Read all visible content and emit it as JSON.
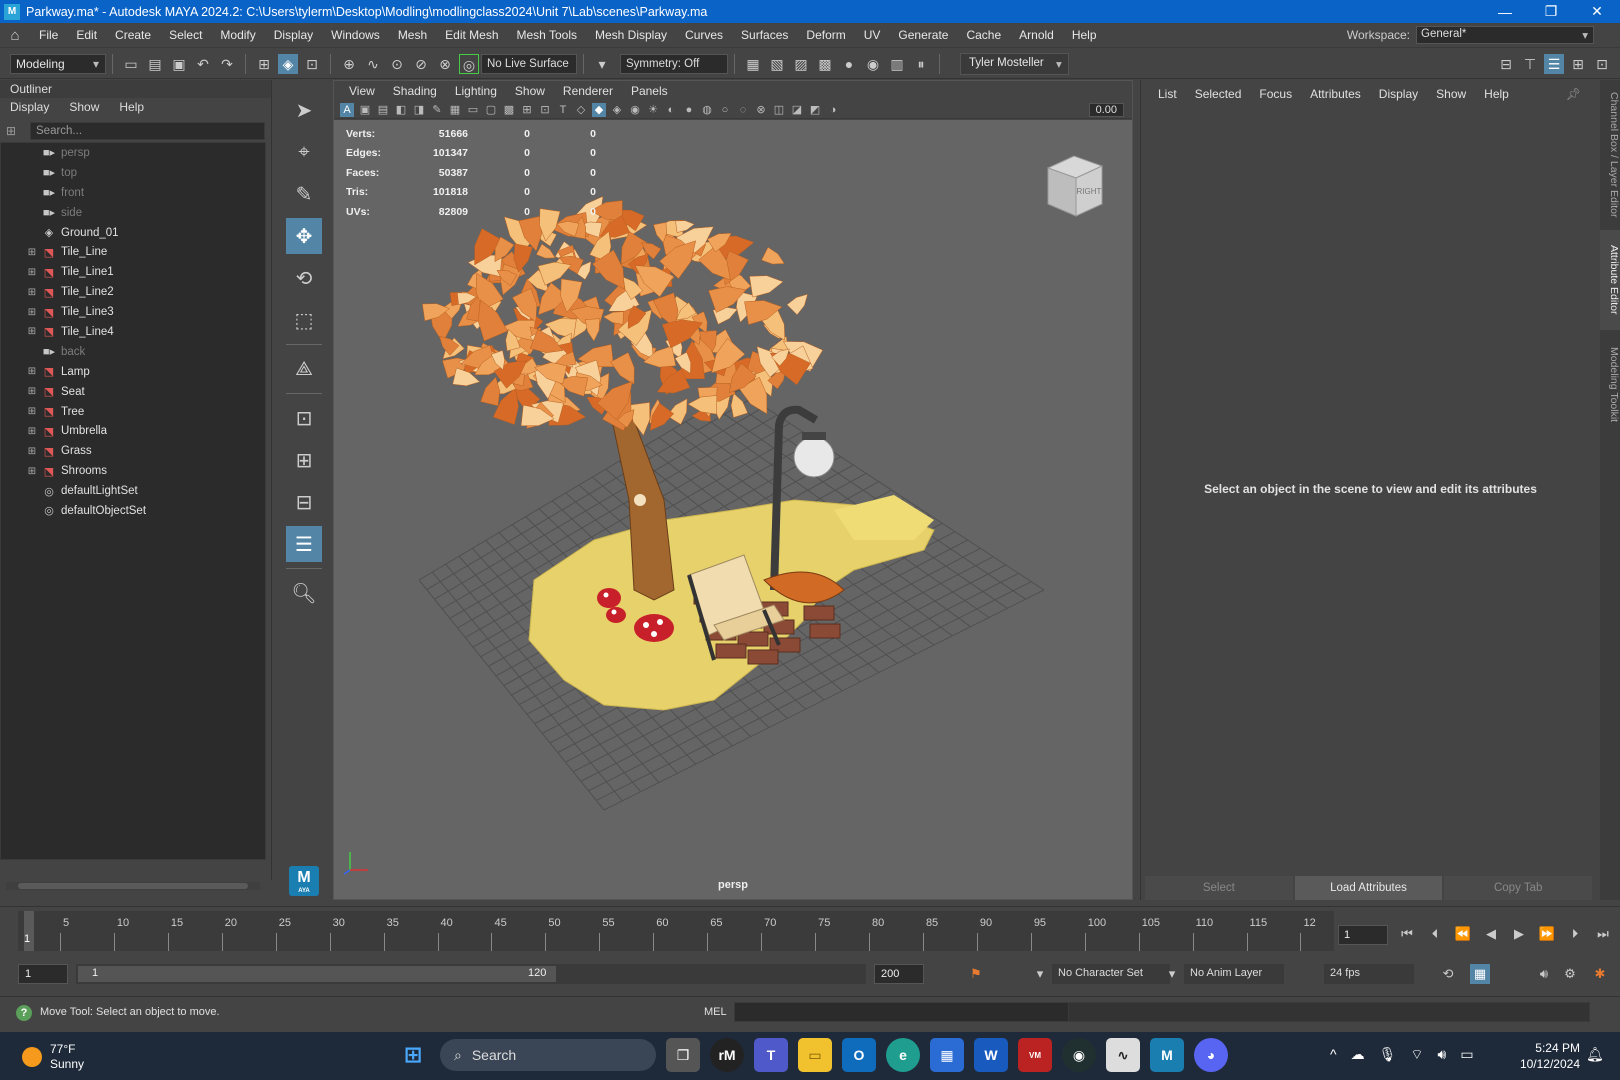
{
  "window": {
    "title": "Parkway.ma* - Autodesk MAYA 2024.2: C:\\Users\\tylerm\\Desktop\\Modling\\modlingclass2024\\Unit 7\\Lab\\scenes\\Parkway.ma",
    "logo": "M",
    "controls": [
      "—",
      "❐",
      "✕"
    ]
  },
  "menubar": {
    "items": [
      "File",
      "Edit",
      "Create",
      "Select",
      "Modify",
      "Display",
      "Windows",
      "Mesh",
      "Edit Mesh",
      "Mesh Tools",
      "Mesh Display",
      "Curves",
      "Surfaces",
      "Deform",
      "UV",
      "Generate",
      "Cache",
      "Arnold",
      "Help"
    ],
    "workspace_label": "Workspace:",
    "workspace_value": "General*"
  },
  "statusline": {
    "mode": "Modeling",
    "live_surface": "No Live Surface",
    "symmetry": "Symmetry: Off",
    "user": "Tyler Mosteller"
  },
  "outliner": {
    "title": "Outliner",
    "menu": [
      "Display",
      "Show",
      "Help"
    ],
    "search_placeholder": "Search...",
    "items": [
      {
        "label": "persp",
        "icon": "camera-icon",
        "dim": true,
        "expandable": false
      },
      {
        "label": "top",
        "icon": "camera-icon",
        "dim": true,
        "expandable": false
      },
      {
        "label": "front",
        "icon": "camera-icon",
        "dim": true,
        "expandable": false
      },
      {
        "label": "side",
        "icon": "camera-icon",
        "dim": true,
        "expandable": false
      },
      {
        "label": "Ground_01",
        "icon": "mesh-icon",
        "dim": false,
        "expandable": false
      },
      {
        "label": "Tile_Line",
        "icon": "group-icon",
        "dim": false,
        "expandable": true
      },
      {
        "label": "Tile_Line1",
        "icon": "group-icon",
        "dim": false,
        "expandable": true
      },
      {
        "label": "Tile_Line2",
        "icon": "group-icon",
        "dim": false,
        "expandable": true
      },
      {
        "label": "Tile_Line3",
        "icon": "group-icon",
        "dim": false,
        "expandable": true
      },
      {
        "label": "Tile_Line4",
        "icon": "group-icon",
        "dim": false,
        "expandable": true
      },
      {
        "label": "back",
        "icon": "camera-icon",
        "dim": true,
        "expandable": false
      },
      {
        "label": "Lamp",
        "icon": "group-icon",
        "dim": false,
        "expandable": true
      },
      {
        "label": "Seat",
        "icon": "group-icon",
        "dim": false,
        "expandable": true
      },
      {
        "label": "Tree",
        "icon": "group-icon",
        "dim": false,
        "expandable": true
      },
      {
        "label": "Umbrella",
        "icon": "group-icon",
        "dim": false,
        "expandable": true
      },
      {
        "label": "Grass",
        "icon": "group-icon",
        "dim": false,
        "expandable": true
      },
      {
        "label": "Shrooms",
        "icon": "group-icon",
        "dim": false,
        "expandable": true
      },
      {
        "label": "defaultLightSet",
        "icon": "set-icon",
        "dim": false,
        "expandable": false
      },
      {
        "label": "defaultObjectSet",
        "icon": "set-icon",
        "dim": false,
        "expandable": false
      }
    ]
  },
  "toolbox": {
    "badge": "M",
    "badge_sub": "AYA"
  },
  "viewport": {
    "menu": [
      "View",
      "Shading",
      "Lighting",
      "Show",
      "Renderer",
      "Panels"
    ],
    "exposure_value": "0.00",
    "hud": [
      {
        "label": "Verts:",
        "v1": "51666",
        "v2": "0",
        "v3": "0"
      },
      {
        "label": "Edges:",
        "v1": "101347",
        "v2": "0",
        "v3": "0"
      },
      {
        "label": "Faces:",
        "v1": "50387",
        "v2": "0",
        "v3": "0"
      },
      {
        "label": "Tris:",
        "v1": "101818",
        "v2": "0",
        "v3": "0"
      },
      {
        "label": "UVs:",
        "v1": "82809",
        "v2": "0",
        "v3": "0"
      }
    ],
    "camera": "persp",
    "viewcube_face": "RIGHT"
  },
  "attribute_editor": {
    "menu": [
      "List",
      "Selected",
      "Focus",
      "Attributes",
      "Display",
      "Show",
      "Help"
    ],
    "message": "Select an object in the scene to view and edit its attributes",
    "buttons": [
      "Select",
      "Load Attributes",
      "Copy Tab"
    ]
  },
  "side_tabs": [
    "Channel Box / Layer Editor",
    "Attribute Editor",
    "Modeling Toolkit"
  ],
  "timeslider": {
    "labels": [
      "5",
      "10",
      "15",
      "20",
      "25",
      "30",
      "35",
      "40",
      "45",
      "50",
      "55",
      "60",
      "65",
      "70",
      "75",
      "80",
      "85",
      "90",
      "95",
      "100",
      "105",
      "110",
      "115",
      "12"
    ],
    "current_marker": "1",
    "current_frame": "1"
  },
  "rangeslider": {
    "start": "1",
    "range_start": "1",
    "range_end": "120",
    "end": "200",
    "character_set": "No Character Set",
    "anim_layer": "No Anim Layer",
    "fps": "24 fps"
  },
  "helpline": {
    "text": "Move Tool: Select an object to move.",
    "mel_label": "MEL"
  },
  "taskbar": {
    "temperature": "77°F",
    "condition": "Sunny",
    "search_label": "Search",
    "time": "5:24 PM",
    "date": "10/12/2024"
  },
  "colors": {
    "titlebar": "#0a64c8",
    "active_tool": "#5285a6",
    "viewport_bg": "#656565",
    "grass": "#e6d16a",
    "leaf_orange": "#e0803a",
    "trunk": "#a2662f"
  }
}
